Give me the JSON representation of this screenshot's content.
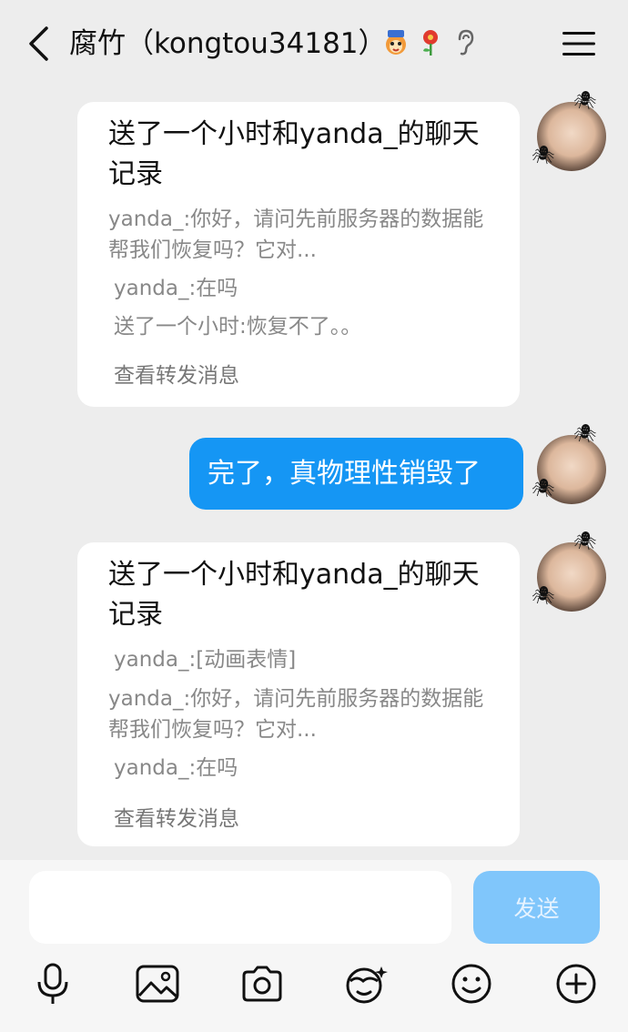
{
  "header": {
    "title": "腐竹（kongtou34181）",
    "badges": [
      "tiger-badge-icon",
      "flower-badge-icon",
      "ear-badge-icon"
    ]
  },
  "messages": [
    {
      "type": "forward-card",
      "title": "送了一个小时和yanda_的聊天记录",
      "lines": [
        "yanda_:你好，请问先前服务器的数据能帮我们恢复吗？它对...",
        "yanda_:在吗",
        "送了一个小时:恢复不了。。"
      ],
      "footer": "查看转发消息"
    },
    {
      "type": "text",
      "text": "完了，真物理性销毁了"
    },
    {
      "type": "forward-card",
      "title": "送了一个小时和yanda_的聊天记录",
      "lines": [
        "yanda_:[动画表情]",
        "yanda_:你好，请问先前服务器的数据能帮我们恢复吗？它对...",
        "yanda_:在吗"
      ],
      "footer": "查看转发消息"
    }
  ],
  "composer": {
    "input_value": "",
    "send_label": "发送"
  },
  "toolbar": [
    "mic-icon",
    "image-icon",
    "camera-icon",
    "sticker-icon",
    "emoji-icon",
    "plus-icon"
  ],
  "colors": {
    "background": "#ededed",
    "bubble": "#1596f4",
    "send_disabled": "#80c6fb"
  }
}
